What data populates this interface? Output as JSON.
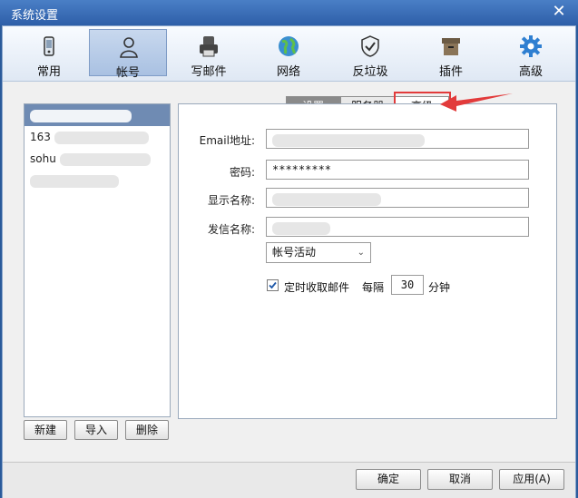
{
  "window": {
    "title": "系统设置"
  },
  "toolbar": {
    "items": [
      {
        "label": "常用",
        "icon": "phone-icon"
      },
      {
        "label": "帐号",
        "icon": "user-icon"
      },
      {
        "label": "写邮件",
        "icon": "printer-icon"
      },
      {
        "label": "网络",
        "icon": "globe-icon"
      },
      {
        "label": "反垃圾",
        "icon": "shield-icon"
      },
      {
        "label": "插件",
        "icon": "box-icon"
      },
      {
        "label": "高级",
        "icon": "gear-icon"
      }
    ],
    "active_index": 1
  },
  "accounts": {
    "items": [
      {
        "prefix": ""
      },
      {
        "prefix": "163"
      },
      {
        "prefix": "sohu"
      }
    ]
  },
  "account_buttons": {
    "new_label": "新建",
    "import_label": "导入",
    "delete_label": "删除"
  },
  "tabs": {
    "settings": "设置",
    "server": "服务器",
    "advanced": "高级"
  },
  "form": {
    "email_label": "Email地址:",
    "password_label": "密码:",
    "password_value": "*********",
    "display_name_label": "显示名称:",
    "sender_name_label": "发信名称:",
    "status_select": "帐号活动",
    "auto_receive_label": "定时收取邮件",
    "interval_prefix": "每隔",
    "interval_value": "30",
    "interval_unit": "分钟"
  },
  "footer": {
    "ok_label": "确定",
    "cancel_label": "取消",
    "apply_label": "应用(A)"
  },
  "colors": {
    "accent": "#2d5ea8",
    "annotation": "#e23b3b"
  }
}
